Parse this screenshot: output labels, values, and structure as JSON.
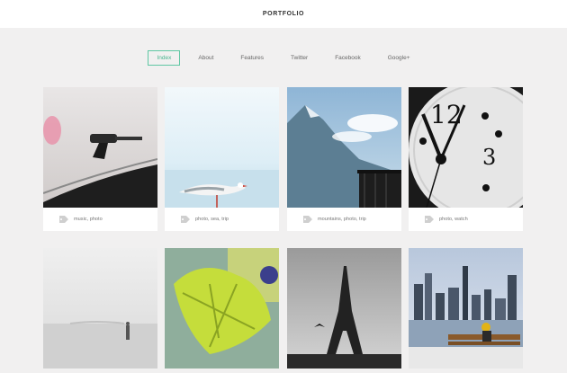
{
  "header": {
    "title": "PORTFOLIO"
  },
  "nav": {
    "items": [
      {
        "label": "Index",
        "active": true
      },
      {
        "label": "About"
      },
      {
        "label": "Features"
      },
      {
        "label": "Twitter"
      },
      {
        "label": "Facebook"
      },
      {
        "label": "Google+"
      }
    ]
  },
  "cards": [
    {
      "tags": "music, photo"
    },
    {
      "tags": "photo, sea, trip"
    },
    {
      "tags": "mountains, photo, trip"
    },
    {
      "tags": "photo, watch"
    },
    {
      "tags": ""
    },
    {
      "tags": ""
    },
    {
      "tags": ""
    },
    {
      "tags": ""
    }
  ],
  "colors": {
    "accent": "#5fc7a3",
    "background": "#f1f0f0"
  },
  "icons": {
    "tag": "tag-icon"
  }
}
